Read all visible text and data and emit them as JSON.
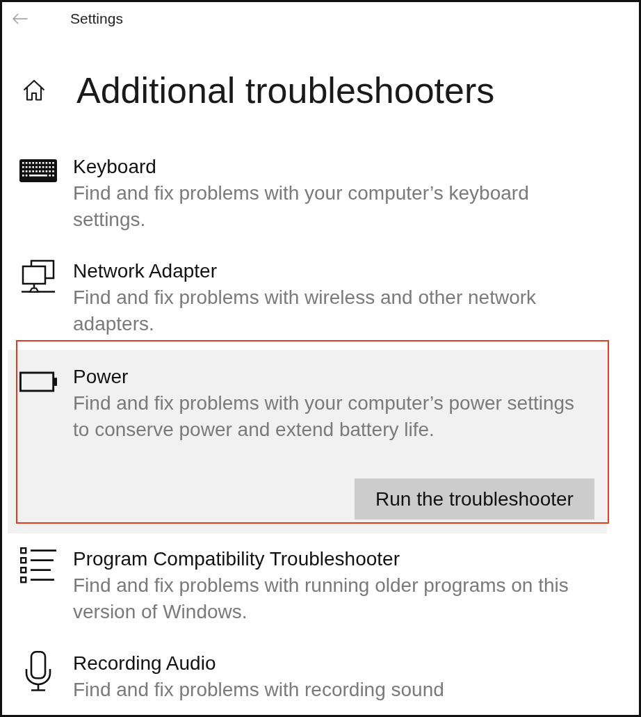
{
  "window": {
    "title": "Settings"
  },
  "page": {
    "title": "Additional troubleshooters"
  },
  "troubleshooters": [
    {
      "title": "Keyboard",
      "description": "Find and fix problems with your computer’s keyboard settings.",
      "selected": false,
      "highlighted": false
    },
    {
      "title": "Network Adapter",
      "description": "Find and fix problems with wireless and other network adapters.",
      "selected": false,
      "highlighted": false
    },
    {
      "title": "Power",
      "description": "Find and fix problems with your computer’s power settings to conserve power and extend battery life.",
      "selected": true,
      "highlighted": true,
      "button": "Run the troubleshooter"
    },
    {
      "title": "Program Compatibility Troubleshooter",
      "description": "Find and fix problems with running older programs on this version of Windows.",
      "selected": false,
      "highlighted": false
    },
    {
      "title": "Recording Audio",
      "description": "Find and fix problems with recording sound",
      "selected": false,
      "highlighted": false
    }
  ]
}
